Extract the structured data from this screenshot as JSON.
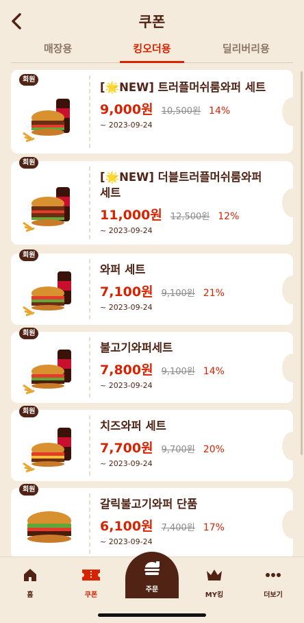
{
  "header": {
    "title": "쿠폰",
    "tabs": [
      {
        "label": "매장용"
      },
      {
        "label": "킹오더용"
      },
      {
        "label": "딜리버리용"
      }
    ]
  },
  "coupons": [
    {
      "badge": "회원",
      "name": "[🌟NEW] 트러플머쉬룸와퍼 세트",
      "price": "9,000원",
      "original": "10,500원",
      "discount": "14%",
      "date": "~ 2023-09-24"
    },
    {
      "badge": "회원",
      "name": "[🌟NEW] 더블트러플머쉬룸와퍼 세트",
      "price": "11,000원",
      "original": "12,500원",
      "discount": "12%",
      "date": "~ 2023-09-24"
    },
    {
      "badge": "회원",
      "name": "와퍼 세트",
      "price": "7,100원",
      "original": "9,100원",
      "discount": "21%",
      "date": "~ 2023-09-24"
    },
    {
      "badge": "회원",
      "name": "불고기와퍼세트",
      "price": "7,800원",
      "original": "9,100원",
      "discount": "14%",
      "date": "~ 2023-09-24"
    },
    {
      "badge": "회원",
      "name": "치즈와퍼 세트",
      "price": "7,700원",
      "original": "9,700원",
      "discount": "20%",
      "date": "~ 2023-09-24"
    },
    {
      "badge": "회원",
      "name": "갈릭불고기와퍼 단품",
      "price": "6,100원",
      "original": "7,400원",
      "discount": "17%",
      "date": "~ 2023-09-24"
    }
  ],
  "nav": {
    "home": "홈",
    "coupon": "쿠폰",
    "order": "주문",
    "myking": "MY킹",
    "more": "더보기"
  },
  "colors": {
    "background": "#f5ebdc",
    "brand_brown": "#502314",
    "accent_red": "#d62300"
  }
}
